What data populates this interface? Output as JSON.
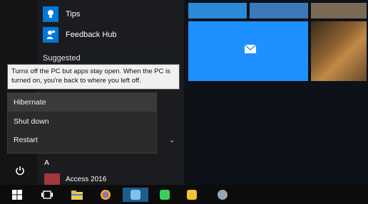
{
  "start_menu": {
    "apps": [
      {
        "label": "Tips",
        "icon": "lightbulb-icon"
      },
      {
        "label": "Feedback Hub",
        "icon": "feedback-person-icon"
      }
    ],
    "section_heading": "Suggested",
    "tooltip": "Turns off the PC but apps stay open. When the PC is turned on, you're back to where you left off.",
    "power_menu": [
      {
        "label": "Hibernate",
        "state": "hovered"
      },
      {
        "label": "Shut down"
      },
      {
        "label": "Restart"
      }
    ],
    "list_letter": "A",
    "first_app": {
      "label": "Access 2016",
      "icon": "access-icon"
    }
  },
  "colors": {
    "accent": "#0078d7",
    "menu_background": "#2b2b2b",
    "tooltip_background": "#f0f0f0",
    "access_red": "#a4373a"
  },
  "taskbar": {
    "items": [
      {
        "name": "start",
        "icon": "windows-logo-icon"
      },
      {
        "name": "task-view",
        "icon": "task-view-icon"
      },
      {
        "name": "file-explorer",
        "icon": "folder-icon"
      },
      {
        "name": "chrome",
        "icon": "chrome-icon"
      },
      {
        "name": "pinned-app-active",
        "icon": "app-icon"
      },
      {
        "name": "pinned-app-green",
        "icon": "app-icon"
      },
      {
        "name": "pinned-app-yellow",
        "icon": "app-icon"
      },
      {
        "name": "pinned-app-gray",
        "icon": "app-icon"
      }
    ]
  }
}
